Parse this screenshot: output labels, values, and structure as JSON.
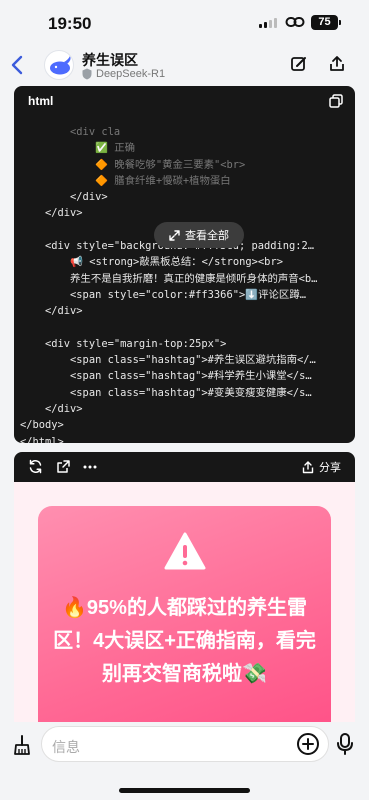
{
  "status": {
    "time": "19:50",
    "battery": "75"
  },
  "header": {
    "title": "养生误区",
    "subtitle": "DeepSeek-R1"
  },
  "code_block": {
    "language": "html",
    "expand_label": "查看全部",
    "lines": [
      "        <div cla",
      "            ✅ 正确",
      "            🔶 晚餐吃够\"黄金三要素\"<br>",
      "            🔶 膳食纤维+慢碳+植物蛋白",
      "        </div>",
      "    </div>",
      "",
      "    <div style=\"background: #fff3cd; padding:2…",
      "        📢 <strong>敲黑板总结：</strong><br>",
      "        养生不是自我折磨！真正的健康是倾听身体的声音<b…",
      "        <span style=\"color:#ff3366\">⬇️评论区蹲…",
      "    </div>",
      "",
      "    <div style=\"margin-top:25px\">",
      "        <span class=\"hashtag\">#养生误区避坑指南</…",
      "        <span class=\"hashtag\">#科学养生小课堂</s…",
      "        <span class=\"hashtag\">#变美变瘦变健康</s…",
      "    </div>",
      "</body>",
      "</html>"
    ]
  },
  "preview": {
    "share_label": "分享",
    "headline": "🔥95%的人都踩过的养生雷区！4大误区+正确指南，看完别再交智商税啦💸"
  },
  "composer": {
    "placeholder": "信息"
  }
}
